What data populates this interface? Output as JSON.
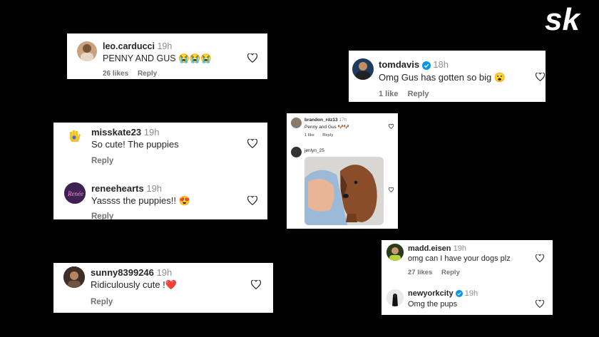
{
  "brand": {
    "logo_text": "sk"
  },
  "card1": {
    "username": "leo.carducci",
    "time": "19h",
    "text": "PENNY AND GUS 😭😭😭",
    "likes": "26 likes",
    "reply": "Reply"
  },
  "card2": {
    "username": "tomdavis",
    "time": "18h",
    "text": "Omg Gus has gotten so big 😮",
    "likes": "1 like",
    "reply": "Reply"
  },
  "card3": {
    "comments": [
      {
        "username": "misskate23",
        "time": "19h",
        "text": "So cute! The puppies",
        "reply": "Reply"
      },
      {
        "username": "reneehearts",
        "time": "19h",
        "text": "Yassss the puppies!! 😍",
        "reply": "Reply"
      }
    ]
  },
  "card4": {
    "username": "brandon_rdz13",
    "time": "17h",
    "text": "Penny and Gus 🐶🐶",
    "likes": "1 like",
    "reply": "Reply",
    "username2": "jenlyn_25"
  },
  "card5": {
    "username": "sunny8399246",
    "time": "19h",
    "text": "Ridiculously cute !❤️",
    "reply": "Reply"
  },
  "card6": {
    "comments": [
      {
        "username": "madd.eisen",
        "time": "19h",
        "text": "omg can I have your dogs plz",
        "likes": "27 likes",
        "reply": "Reply"
      },
      {
        "username": "newyorkcity",
        "time": "19h",
        "text": "Omg the pups"
      }
    ]
  },
  "colors": {
    "background": "#000000",
    "card": "#ffffff",
    "verified": "#0095f6",
    "heart_red": "#e0245e"
  }
}
